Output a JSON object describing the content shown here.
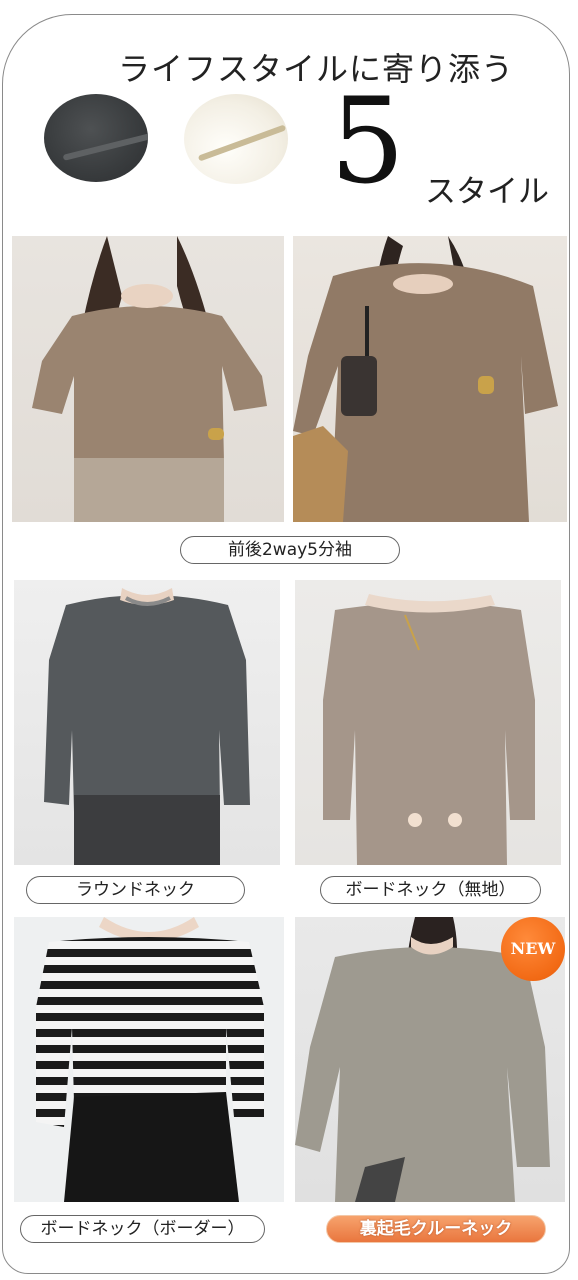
{
  "header": {
    "title": "ライフスタイルに寄り添う",
    "number": "5",
    "suffix": "スタイル"
  },
  "swatches": [
    {
      "name": "dark-gray-fabric",
      "color": "#3c3f41"
    },
    {
      "name": "ivory-fleece-fabric",
      "color": "#f4f0e6"
    }
  ],
  "styles": [
    {
      "label": "前後2way5分袖"
    },
    {
      "label": "ラウンドネック"
    },
    {
      "label": "ボードネック（無地）"
    },
    {
      "label": "ボードネック（ボーダー）"
    },
    {
      "label": "裏起毛クルーネック"
    }
  ],
  "badge": {
    "text": "NEW",
    "color": "#f26a15"
  },
  "colors": {
    "mocha": "#9a8470",
    "charcoal": "#55595c",
    "taupe": "#a5968a",
    "stripe_black": "#1a1a1a",
    "gray_beige": "#9e9a90",
    "label_orange": "#ee7f46"
  }
}
